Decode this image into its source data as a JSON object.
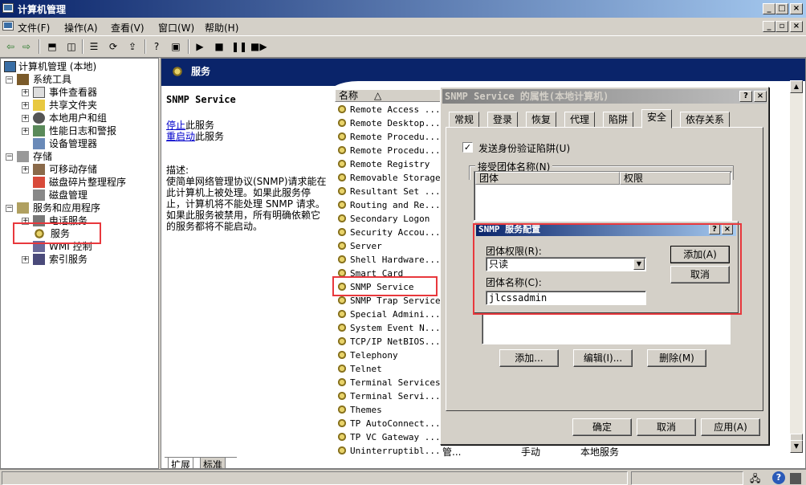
{
  "window": {
    "title": "计算机管理"
  },
  "menu": [
    {
      "label": "文件(F)"
    },
    {
      "label": "操作(A)"
    },
    {
      "label": "查看(V)"
    },
    {
      "label": "窗口(W)"
    },
    {
      "label": "帮助(H)"
    }
  ],
  "tree": {
    "root": "计算机管理 (本地)",
    "system_tools": "系统工具",
    "event_viewer": "事件查看器",
    "shared_folders": "共享文件夹",
    "local_users": "本地用户和组",
    "perf_logs": "性能日志和警报",
    "device_manager": "设备管理器",
    "storage": "存储",
    "removable": "可移动存储",
    "defrag": "磁盘碎片整理程序",
    "disk_mgmt": "磁盘管理",
    "services_apps": "服务和应用程序",
    "telephony": "电话服务",
    "services": "服务",
    "wmi": "WMI 控制",
    "indexing": "索引服务"
  },
  "header": {
    "title": "服务"
  },
  "details": {
    "service_name": "SNMP Service",
    "stop_link": "停止",
    "stop_suffix": "此服务",
    "restart_link": "重启动",
    "restart_suffix": "此服务",
    "desc_label": "描述:",
    "desc_lines": [
      "使简单网络管理协议(SNMP)请求能在",
      "此计算机上被处理。如果此服务停",
      "止，计算机将不能处理 SNMP 请求。",
      "如果此服务被禁用，所有明确依赖它",
      "的服务都将不能启动。"
    ]
  },
  "service_list": {
    "col_name": "名称",
    "items": [
      "Remote Access ...",
      "Remote Desktop...",
      "Remote Procedu...",
      "Remote Procedu...",
      "Remote Registry",
      "Removable Storage",
      "Resultant Set ...",
      "Routing and Re...",
      "Secondary Logon",
      "Security Accou...",
      "Server",
      "Shell Hardware...",
      "Smart Card",
      "SNMP Service",
      "SNMP Trap Service",
      "Special Admini...",
      "System Event N...",
      "TCP/IP NetBIOS...",
      "Telephony",
      "Telnet",
      "Terminal Services",
      "Terminal Servi...",
      "Themes",
      "TP AutoConnect...",
      "TP VC Gateway ...",
      "Uninterruptibl..."
    ],
    "last_row_desc": "管...",
    "last_row_startup": "手动",
    "last_row_logon": "本地服务"
  },
  "prop_dialog": {
    "title": "SNMP Service 的属性(本地计算机)",
    "tabs": [
      "常规",
      "登录",
      "恢复",
      "代理",
      "陷阱",
      "安全",
      "依存关系"
    ],
    "send_auth_trap": "发送身份验证陷阱(U)",
    "accepted_communities": "接受团体名称(N)",
    "col_community": "团体",
    "col_rights": "权限",
    "add_btn": "添加...",
    "edit_btn": "编辑(I)...",
    "remove_btn": "删除(M)",
    "ok": "确定",
    "cancel": "取消",
    "apply": "应用(A)"
  },
  "cfg_dialog": {
    "title": "SNMP 服务配置",
    "rights_label": "团体权限(R):",
    "rights_value": "只读",
    "name_label": "团体名称(C):",
    "name_value": "jlcssadmin",
    "add_btn": "添加(A)",
    "cancel_btn": "取消"
  },
  "bottom_tabs": [
    "扩展",
    "标准"
  ],
  "colors": {
    "highlight": "#e8383d",
    "titlebar": "#0a246a"
  }
}
